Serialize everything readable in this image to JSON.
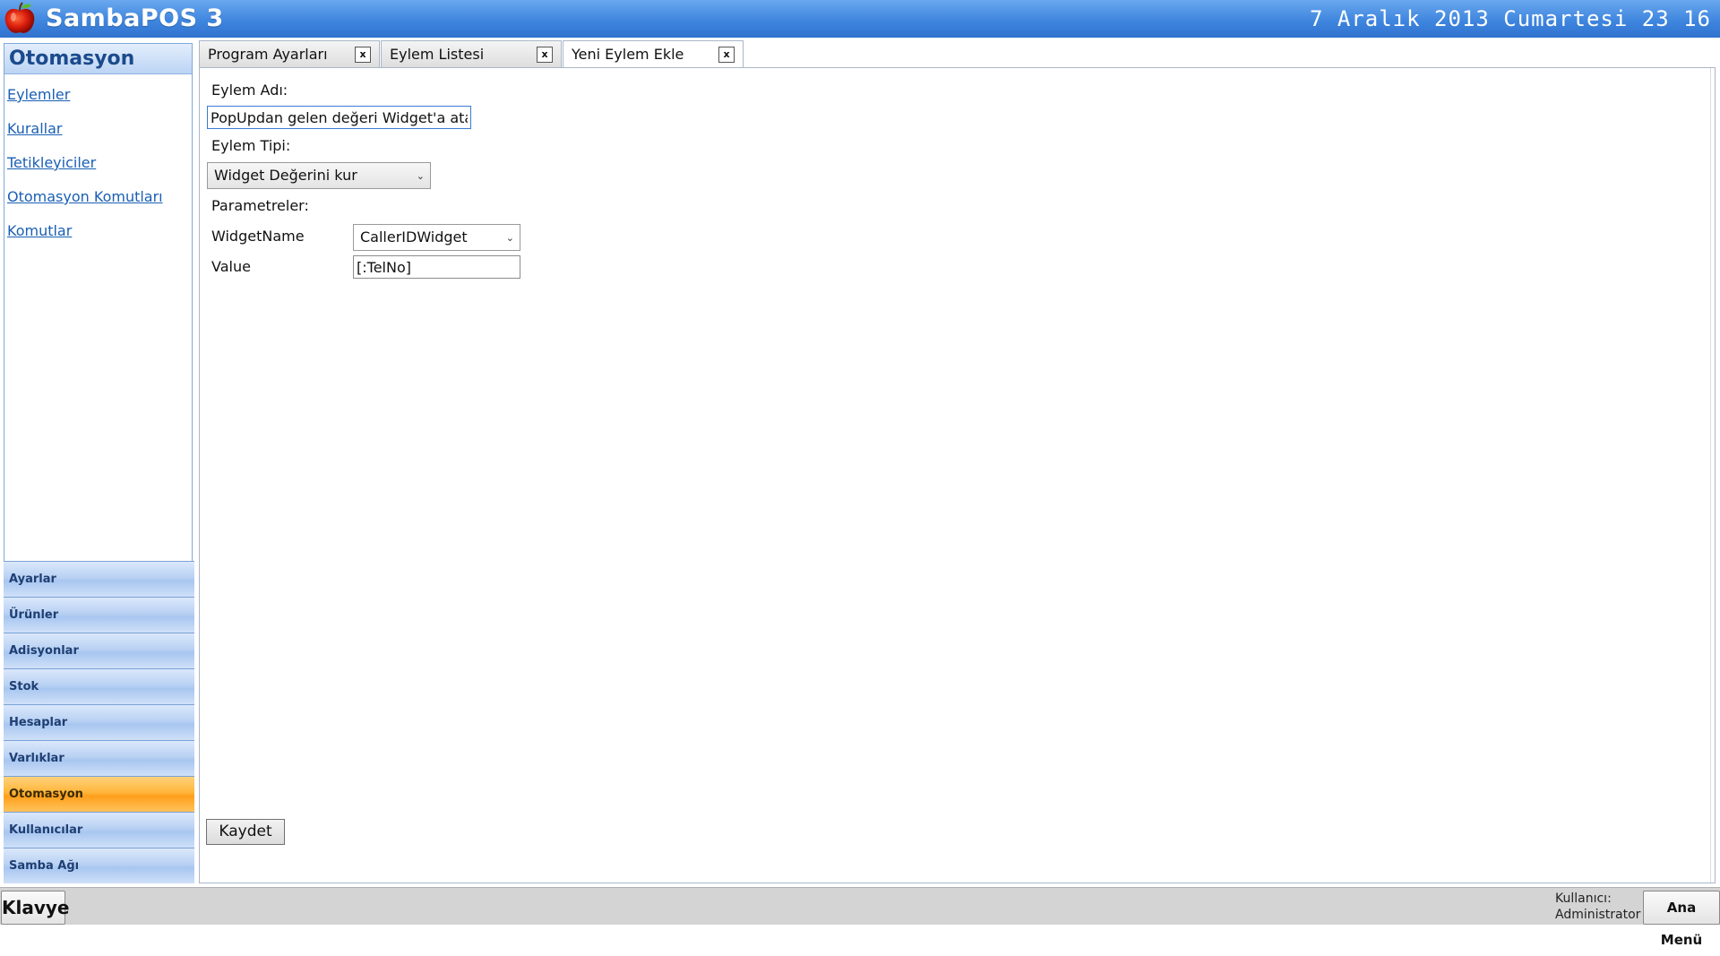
{
  "app": {
    "title": "SambaPOS 3",
    "clock": "7 Aralık 2013 Cumartesi 23 16",
    "logo_icon": "apple-icon"
  },
  "left_panel": {
    "header": "Otomasyon",
    "links": [
      "Eylemler",
      "Kurallar",
      "Tetikleyiciler",
      "Otomasyon Komutları",
      "Komutlar"
    ],
    "nav": [
      "Ayarlar",
      "Ürünler",
      "Adisyonlar",
      "Stok",
      "Hesaplar",
      "Varlıklar",
      "Otomasyon",
      "Kullanıcılar",
      "Samba Ağı"
    ],
    "active_nav": "Otomasyon"
  },
  "tabs": [
    {
      "label": "Program Ayarları",
      "close": "x"
    },
    {
      "label": "Eylem Listesi",
      "close": "x"
    },
    {
      "label": "Yeni Eylem Ekle",
      "close": "x",
      "active": true
    }
  ],
  "form": {
    "name_label": "Eylem Adı:",
    "name_value": "PopUpdan gelen değeri Widget'a ata",
    "type_label": "Eylem Tipi:",
    "type_value": "Widget Değerini kur",
    "params_label": "Parametreler:",
    "params": [
      {
        "label": "WidgetName",
        "value": "CallerIDWidget",
        "kind": "select"
      },
      {
        "label": "Value",
        "value": "[:TelNo]",
        "kind": "text"
      }
    ],
    "save_label": "Kaydet"
  },
  "bottom": {
    "keyboard_label": "Klavye",
    "user_label": "Kullanıcı:",
    "user_name": "Administrator",
    "main_menu_label": "Ana Menü"
  },
  "colors": {
    "titlebar": "#3f86df",
    "active_nav": "#ffb53a",
    "link": "#1a5fb4"
  }
}
